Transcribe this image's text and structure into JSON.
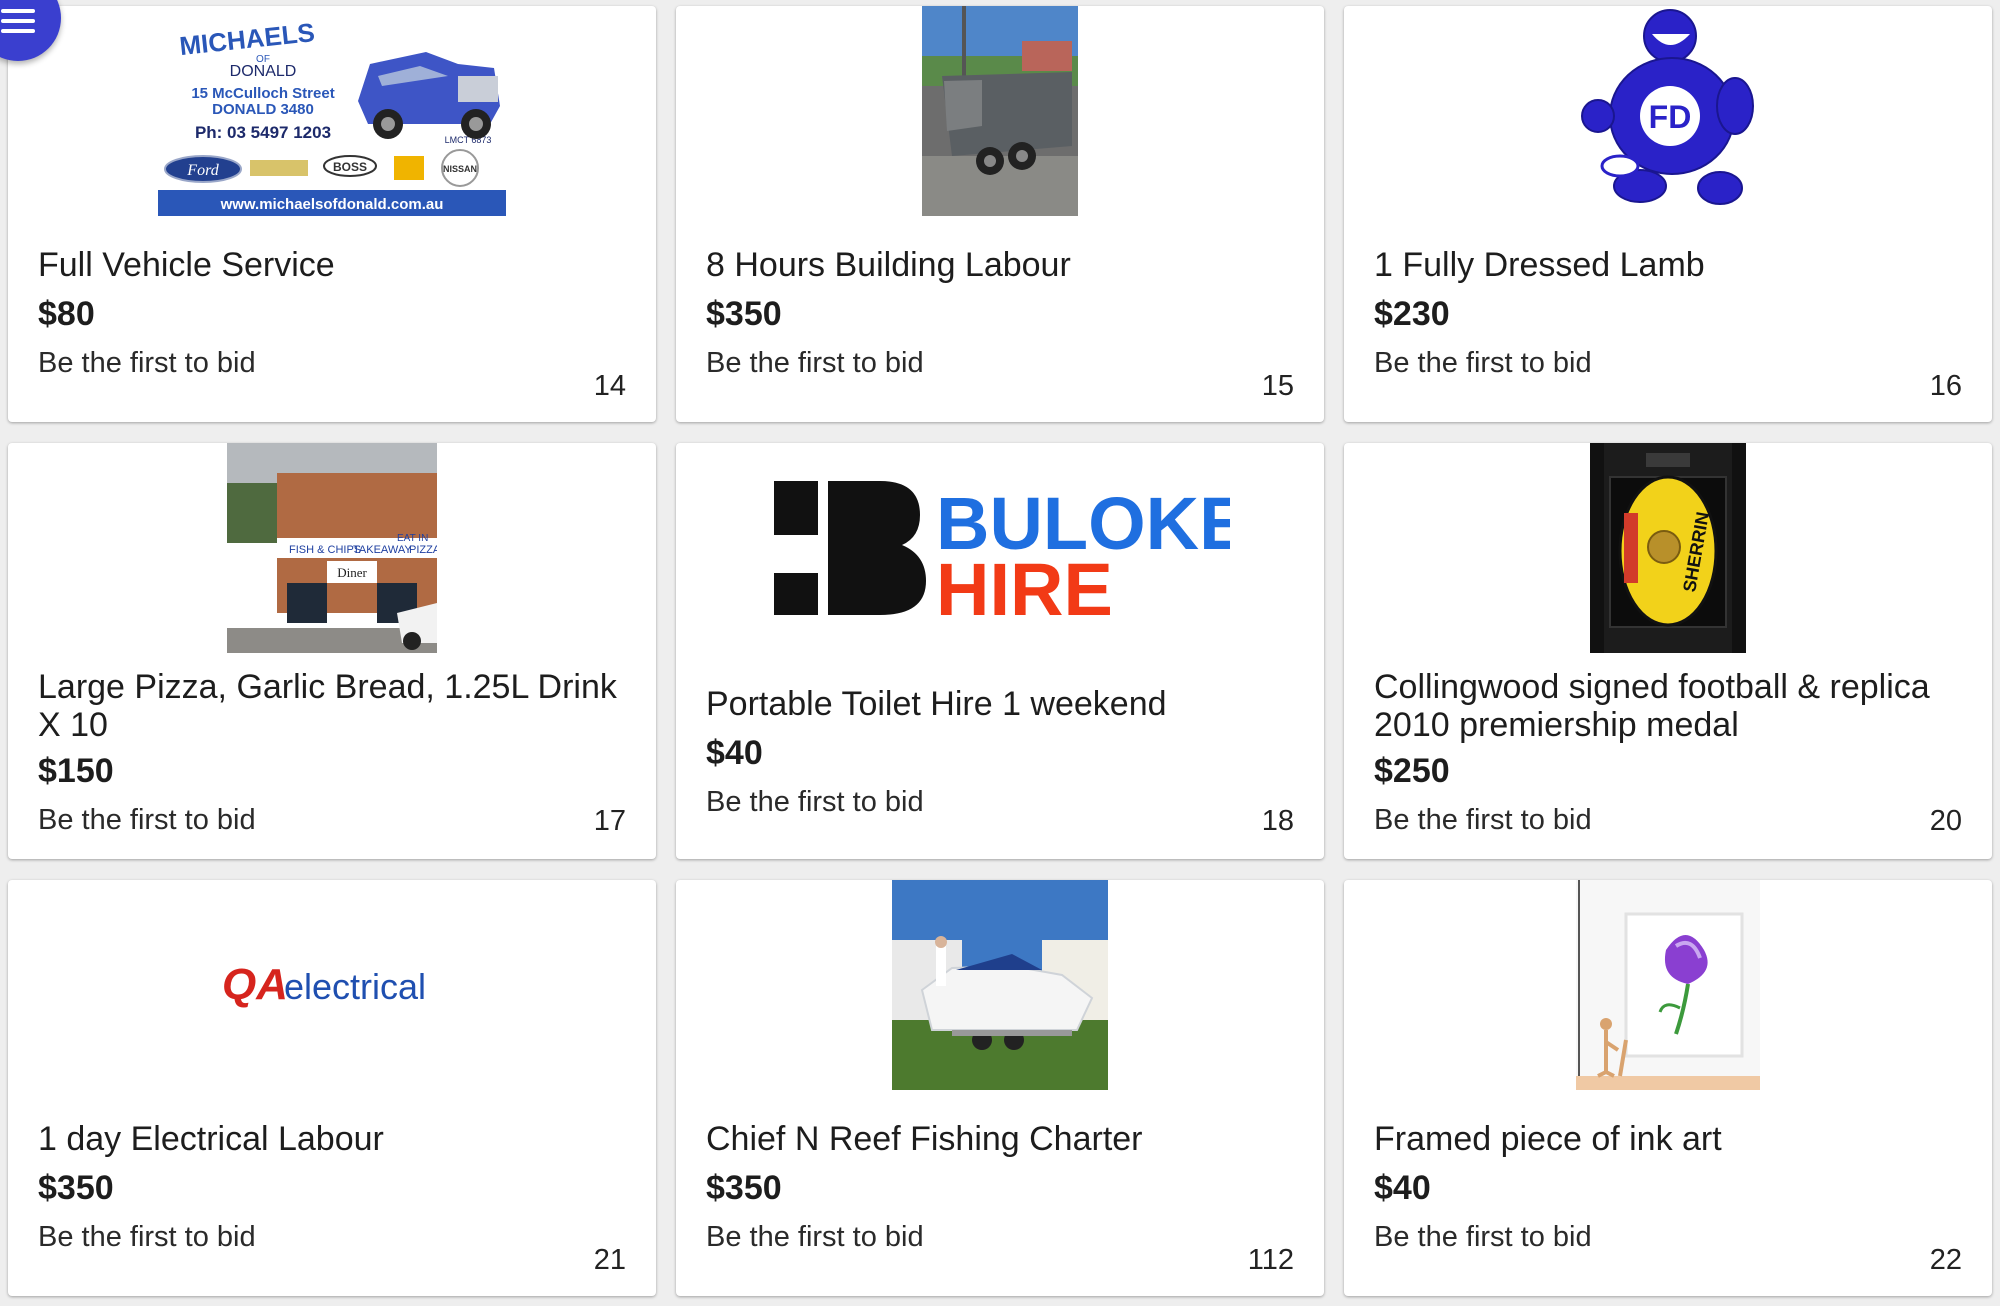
{
  "colors": {
    "menu_button": "#3a3fcf",
    "buloke_blue": "#1f6fe0",
    "buloke_red": "#f23a16",
    "qa_red": "#d6241d",
    "qa_blue": "#1f4fb0"
  },
  "menu": {
    "icon": "hamburger-menu-icon"
  },
  "items": [
    {
      "title": "Full Vehicle Service",
      "price": "$80",
      "bid_status": "Be the first to bid",
      "lot": "14",
      "image": {
        "type": "dealer-ad",
        "brand": "MICHAELS",
        "of": "OF",
        "town": "DONALD",
        "address1": "15 McCulloch Street",
        "address2": "DONALD 3480",
        "phone": "Ph: 03 5497 1203",
        "licence": "LMCT 6873",
        "logos": [
          "Ford",
          "BOSS",
          "NISSAN"
        ],
        "website": "www.michaelsofdonald.com.au"
      }
    },
    {
      "title": "8 Hours Building Labour",
      "price": "$350",
      "bid_status": "Be the first to bid",
      "lot": "15",
      "image": {
        "type": "trailer-photo"
      }
    },
    {
      "title": "1 Fully Dressed Lamb",
      "price": "$230",
      "bid_status": "Be the first to bid",
      "lot": "16",
      "image": {
        "type": "mascot-logo"
      }
    },
    {
      "title": "Large Pizza, Garlic Bread, 1.25L Drink X 10",
      "price": "$150",
      "bid_status": "Be the first to bid",
      "lot": "17",
      "image": {
        "type": "shopfront-photo",
        "sign1": "FISH & CHIPS",
        "sign2": "TAKEAWAY",
        "sign3": "EAT IN",
        "sign4": "PIZZA",
        "shop_name": "Diner"
      }
    },
    {
      "title": "Portable Toilet Hire 1 weekend",
      "price": "$40",
      "bid_status": "Be the first to bid",
      "lot": "18",
      "image": {
        "type": "hire-logo",
        "word1": "BULOKE",
        "word2": "HIRE"
      }
    },
    {
      "title": "Collingwood signed football & replica 2010 premiership medal",
      "price": "$250",
      "bid_status": "Be the first to bid",
      "lot": "20",
      "image": {
        "type": "football-case-photo",
        "ball_text": "SHERRIN"
      }
    },
    {
      "title": "1 day Electrical Labour",
      "price": "$350",
      "bid_status": "Be the first to bid",
      "lot": "21",
      "image": {
        "type": "electrical-logo",
        "part1": "QA",
        "part2": "electrical"
      }
    },
    {
      "title": "Chief N Reef Fishing Charter",
      "price": "$350",
      "bid_status": "Be the first to bid",
      "lot": "112",
      "image": {
        "type": "boat-photo"
      }
    },
    {
      "title": "Framed piece of ink art",
      "price": "$40",
      "bid_status": "Be the first to bid",
      "lot": "22",
      "image": {
        "type": "ink-art-photo"
      }
    }
  ]
}
